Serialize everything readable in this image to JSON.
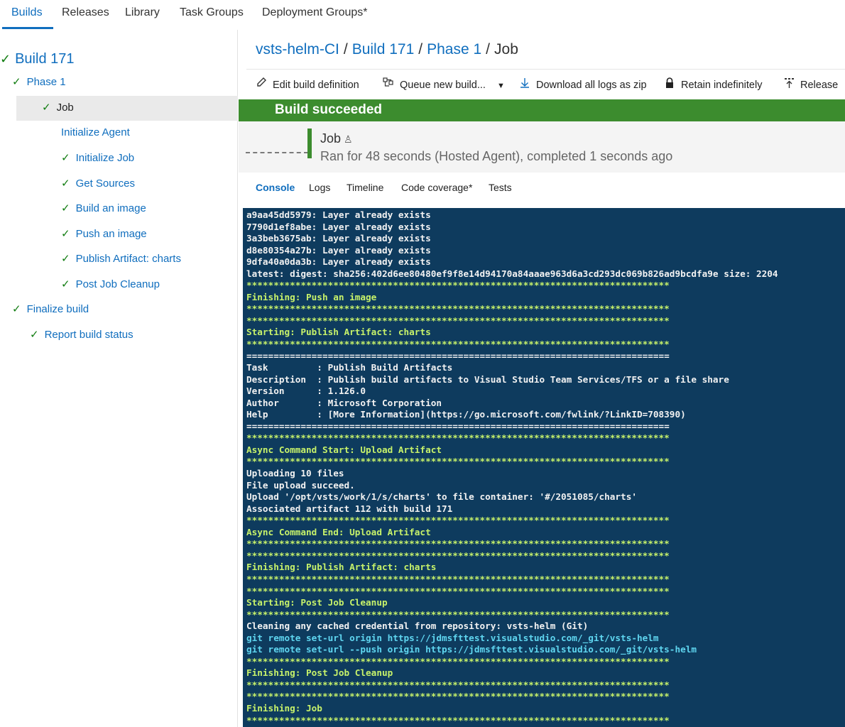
{
  "topnav": {
    "tabs": [
      "Builds",
      "Releases",
      "Library",
      "Task Groups",
      "Deployment Groups*"
    ]
  },
  "tree": {
    "build": "Build 171",
    "phase": "Phase 1",
    "job": "Job",
    "steps": [
      "Initialize Agent",
      "Initialize Job",
      "Get Sources",
      "Build an image",
      "Push an image",
      "Publish Artifact: charts",
      "Post Job Cleanup"
    ],
    "finalize": "Finalize build",
    "report": "Report build status"
  },
  "breadcrumb": {
    "definition": "vsts-helm-CI",
    "build": "Build 171",
    "phase": "Phase 1",
    "current": "Job",
    "separator": "/"
  },
  "toolbar": {
    "edit": "Edit build definition",
    "queue": "Queue new build...",
    "download": "Download all logs as zip",
    "retain": "Retain indefinitely",
    "release": "Release"
  },
  "banner": {
    "status": "Build succeeded"
  },
  "job": {
    "title": "Job",
    "summary": "Ran for 48 seconds (Hosted Agent), completed 1 seconds ago"
  },
  "subtabs": [
    "Console",
    "Logs",
    "Timeline",
    "Code coverage*",
    "Tests"
  ],
  "colors": {
    "accent": "#106ebe",
    "success": "#3c8c2e",
    "console_bg": "#0e3b5e",
    "console_text": "#f2f2f2",
    "console_highlight": "#c7f26a",
    "console_command": "#5fd6f0"
  },
  "console": {
    "lines": [
      "a9aa45dd5979: Layer already exists",
      "7790d1ef8abe: Layer already exists",
      "3a3beb3675ab: Layer already exists",
      "d8e80354a27b: Layer already exists",
      "9dfa40a0da3b: Layer already exists",
      "latest: digest: sha256:402d6ee80480ef9f8e14d94170a84aaae963d6a3cd293dc069b826ad9bcdfa9e size: 2204",
      "******************************************************************************",
      "Finishing: Push an image",
      "******************************************************************************",
      "******************************************************************************",
      "Starting: Publish Artifact: charts",
      "******************************************************************************",
      "==============================================================================",
      "Task         : Publish Build Artifacts",
      "Description  : Publish build artifacts to Visual Studio Team Services/TFS or a file share",
      "Version      : 1.126.0",
      "Author       : Microsoft Corporation",
      "Help         : [More Information](https://go.microsoft.com/fwlink/?LinkID=708390)",
      "==============================================================================",
      "******************************************************************************",
      "Async Command Start: Upload Artifact",
      "******************************************************************************",
      "Uploading 10 files",
      "File upload succeed.",
      "Upload '/opt/vsts/work/1/s/charts' to file container: '#/2051085/charts'",
      "Associated artifact 112 with build 171",
      "******************************************************************************",
      "Async Command End: Upload Artifact",
      "******************************************************************************",
      "******************************************************************************",
      "Finishing: Publish Artifact: charts",
      "******************************************************************************",
      "******************************************************************************",
      "Starting: Post Job Cleanup",
      "******************************************************************************",
      "Cleaning any cached credential from repository: vsts-helm (Git)",
      "git remote set-url origin https://jdmsfttest.visualstudio.com/_git/vsts-helm",
      "git remote set-url --push origin https://jdmsfttest.visualstudio.com/_git/vsts-helm",
      "******************************************************************************",
      "Finishing: Post Job Cleanup",
      "******************************************************************************",
      "******************************************************************************",
      "Finishing: Job",
      "******************************************************************************"
    ]
  }
}
